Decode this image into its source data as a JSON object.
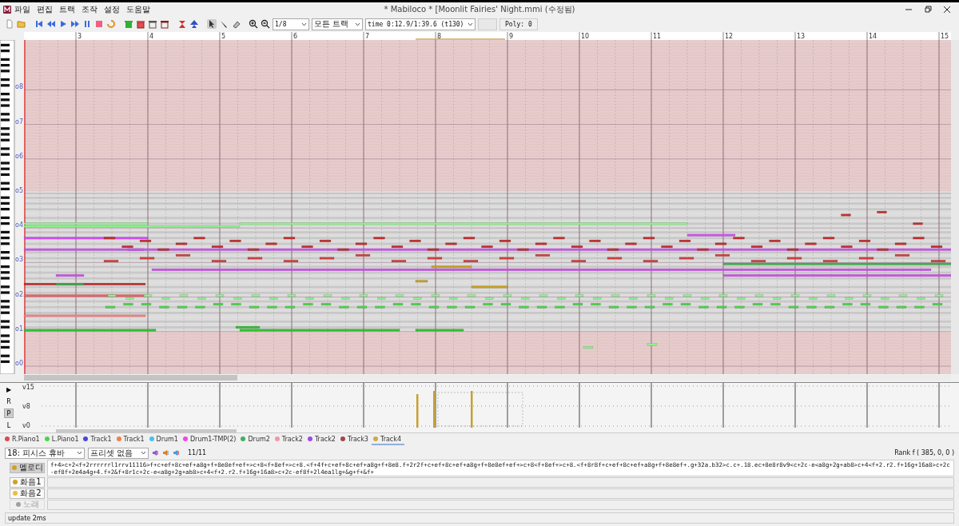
{
  "window": {
    "title": "* Mabiloco * [Moonlit Fairies' Night.mmi (수정됨)"
  },
  "menu": [
    "파일",
    "편집",
    "트랙",
    "조작",
    "설정",
    "도움말"
  ],
  "toolbar": {
    "grid": "1/8",
    "track_filter": "모든 트랙",
    "time": "time 0:12.9/1:39.6 (t130)",
    "poly": "Poly: 0"
  },
  "ruler": {
    "measures": [
      "3",
      "4",
      "5",
      "6",
      "7",
      "8",
      "9",
      "10",
      "11",
      "12",
      "13",
      "14",
      "15"
    ]
  },
  "octaves": [
    "o8",
    "o7",
    "o6",
    "o5",
    "o4",
    "o3",
    "o2",
    "o1",
    "o0"
  ],
  "velocity": {
    "labels": [
      "v15",
      "v8",
      "v0"
    ],
    "modes": [
      {
        "label": "▶",
        "selected": false
      },
      {
        "label": "R",
        "selected": false
      },
      {
        "label": "P",
        "selected": true
      },
      {
        "label": "L",
        "selected": false
      }
    ]
  },
  "tracks": [
    {
      "name": "R.Piano1",
      "color": "#e04848",
      "selected": false
    },
    {
      "name": "L.Piano1",
      "color": "#48d848",
      "selected": false
    },
    {
      "name": "Track1",
      "color": "#4848d8",
      "selected": false
    },
    {
      "name": "Track1",
      "color": "#f08048",
      "selected": false
    },
    {
      "name": "Drum1",
      "color": "#48c0f0",
      "selected": false
    },
    {
      "name": "Drum1-TMP(2)",
      "color": "#f048e0",
      "selected": false
    },
    {
      "name": "Drum2",
      "color": "#40b060",
      "selected": false
    },
    {
      "name": "Track2",
      "color": "#f098a8",
      "selected": false
    },
    {
      "name": "Track2",
      "color": "#a048f0",
      "selected": false
    },
    {
      "name": "Track3",
      "color": "#a04848",
      "selected": false
    },
    {
      "name": "Track4",
      "color": "#d0a848",
      "selected": true
    }
  ],
  "instrument": "18: 피시스 휴바",
  "preset": "프리셋 없음",
  "page": "11/11",
  "rank": "Rank f ( 385, 0, 0 )",
  "parts": [
    {
      "label": "멜로디",
      "color": "#d4a020",
      "selected": true,
      "disabled": false,
      "mml": "f+4>c+2<f+2rrrrrrl1rrv11116>f+c+ef+8c+ef+a8g+f+8e8ef+ef+>c+8<f+8ef+>c+8.<f+4f+c+ef+8c+ef+a8g+f+8e8.f+2r2f+c+ef+8c+ef+a8g+f+8e8ef+ef+>c+8<f+8ef+>c+8.<f+8r8f+c+ef+8c+ef+a8g+f+8e8ef+.g+32a.b32>c.c+.18.ec+8e8r8v9<c+2c-e<a8g+2g+ab8>c+4<f+2.r2.f+16g+16a8>c+2c-ef8f+2e4a4g+4.f+2&f+8r1c+2c-e<a8g+2g+ab8>c+4<f+2.r2.f+16g+16a8>c+2c-ef8f+2l4ea1lg+&g+f+&f+"
    },
    {
      "label": "화음1",
      "color": "#d4a020",
      "selected": false,
      "disabled": false
    },
    {
      "label": "화음2",
      "color": "#e8c040",
      "selected": false,
      "disabled": false
    },
    {
      "label": "노래",
      "color": "#a0a0a0",
      "selected": false,
      "disabled": true
    }
  ],
  "status": "update 2ms"
}
